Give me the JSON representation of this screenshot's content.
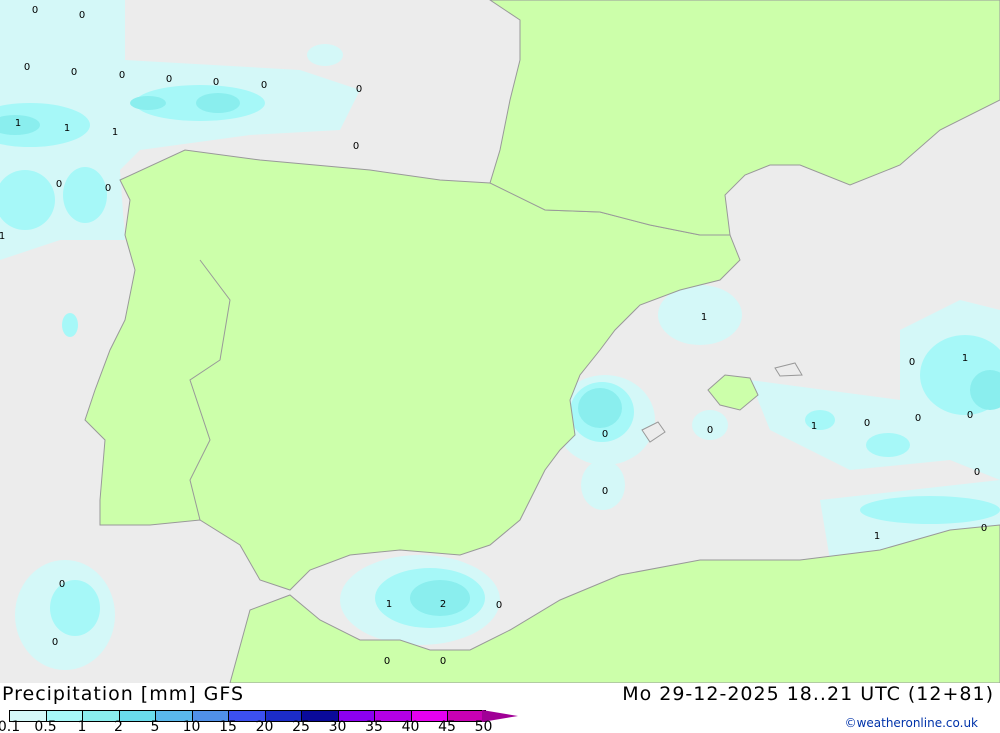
{
  "title": "Precipitation [mm] GFS",
  "valid_time": "Mo 29-12-2025 18..21 UTC (12+81)",
  "credit": "©weatheronline.co.uk",
  "colors": {
    "sea": "#ececec",
    "land": "#ccffaa",
    "border": "#999999"
  },
  "legend": {
    "ticks": [
      "0.1",
      "0.5",
      "1",
      "2",
      "5",
      "10",
      "15",
      "20",
      "25",
      "30",
      "35",
      "40",
      "45",
      "50"
    ],
    "colors": [
      "#d4f8f8",
      "#a6f8f8",
      "#8aeeee",
      "#6adcec",
      "#5ab8ec",
      "#5090e8",
      "#3c50f0",
      "#1c2cc8",
      "#0a0a9a",
      "#8c00f0",
      "#b400e6",
      "#e600f0",
      "#c800b4"
    ],
    "overflow_color": "#a00096"
  },
  "map_labels": [
    "0",
    "0",
    "0",
    "0",
    "0",
    "0",
    "0",
    "0",
    "0",
    "1",
    "1",
    "1",
    "0",
    "0",
    "0",
    "1",
    "1",
    "0",
    "1",
    "0",
    "0",
    "1",
    "0",
    "0",
    "0",
    "0",
    "0",
    "1",
    "0",
    "0",
    "1",
    "2",
    "0",
    "0",
    "0",
    "0"
  ]
}
